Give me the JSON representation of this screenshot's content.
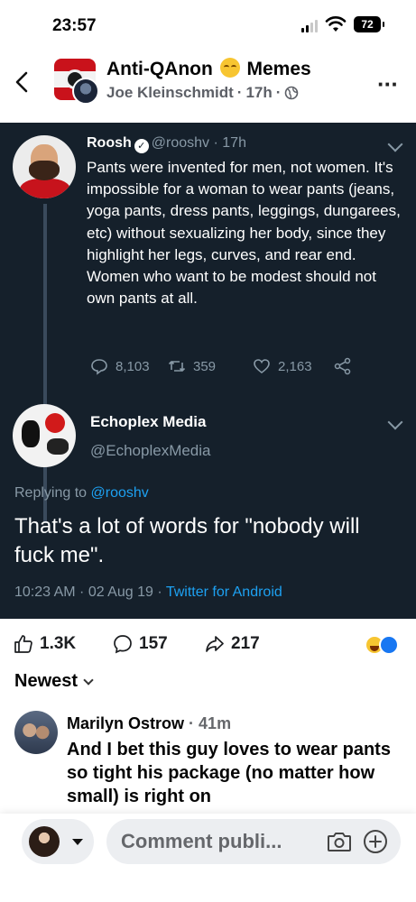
{
  "status_bar": {
    "time": "23:57",
    "battery": "72"
  },
  "post": {
    "group_name": "Anti-QAnon",
    "group_name_suffix": "Memes",
    "author": "Joe Kleinschmidt",
    "time": "17h",
    "separator": "·"
  },
  "tweet": {
    "name": "Roosh",
    "handle": "@rooshv",
    "time": "17h",
    "text": "Pants were invented for men, not women. It's impossible for a woman to wear pants (jeans, yoga pants, dress pants, leggings, dungarees, etc) without sexualizing her body, since they highlight her legs, curves, and rear end. Women who want to be modest should not own pants at all.",
    "replies": "8,103",
    "retweets": "359",
    "likes": "2,163"
  },
  "reply_tweet": {
    "name": "Echoplex Media",
    "handle": "@EchoplexMedia",
    "replying_label": "Replying to",
    "replying_to": "@rooshv",
    "text": "That's a lot of words for \"nobody will fuck me\".",
    "timestamp": "10:23 AM · 02 Aug 19 ·",
    "client": "Twitter for Android"
  },
  "reactions": {
    "likes": "1.3K",
    "comments": "157",
    "shares": "217"
  },
  "sort": {
    "label": "Newest"
  },
  "comment": {
    "author": "Marilyn Ostrow",
    "time": "· 41m",
    "text": "And I bet this guy loves to wear pants so tight his package (no matter how small) is right on"
  },
  "composer": {
    "placeholder": "Comment publi..."
  },
  "colors": {
    "tweet_bg": "#15202b",
    "twitter_blue": "#1da1f2",
    "muted": "#8899a6",
    "facebook_blue": "#1877f2"
  },
  "icons": [
    "back-icon",
    "globe-icon",
    "more-icon",
    "verified-icon",
    "chevron-down-icon",
    "reply-icon",
    "retweet-icon",
    "heart-icon",
    "share-icon",
    "like-icon",
    "comment-icon",
    "share-arrow-icon",
    "camera-icon",
    "plus-icon"
  ]
}
